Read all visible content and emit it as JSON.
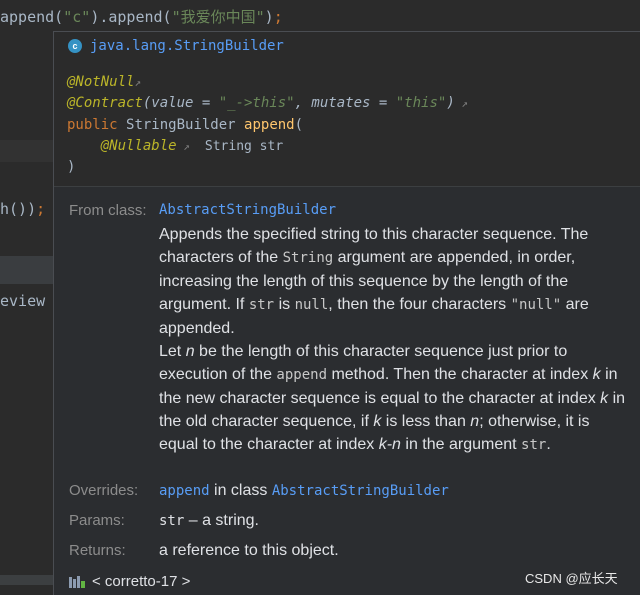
{
  "editor": {
    "line1": {
      "prefix": "append(",
      "arg1": "\"c\"",
      "mid": ").append(",
      "arg2": "\"我爱你中国\"",
      "suffix": ")",
      "semi": ";"
    },
    "line_h": {
      "text": "h())",
      "semi": ";"
    },
    "line_review": "eview"
  },
  "popup": {
    "class_badge": "c",
    "class_name": "java.lang.StringBuilder",
    "signature": {
      "notnull": "@NotNull",
      "contract_ann": "@Contract",
      "contract_open": "(value = ",
      "contract_value": "\"_->this\"",
      "contract_mid": ", mutates = ",
      "contract_mutates": "\"this\"",
      "contract_close": ")",
      "modifier": "public",
      "return_type": "StringBuilder",
      "method": "append",
      "paren_open": "(",
      "nullable": "@Nullable",
      "param_decl": "String str",
      "paren_close": ")"
    },
    "from_label": "From class:",
    "from_class": "AbstractStringBuilder",
    "description": {
      "p1_a": "Appends the specified string to this character sequence. The characters of the ",
      "p1_code1": "String",
      "p1_b": " argument are appended, in order, increasing the length of this sequence by the length of the argument. If ",
      "p1_code2": "str",
      "p1_c": " is ",
      "p1_code3": "null",
      "p1_d": ", then the four characters ",
      "p1_code4": "\"null\"",
      "p1_e": " are appended.",
      "p2_a": "Let ",
      "p2_n1": "n",
      "p2_b": " be the length of this character sequence just prior to execution of the ",
      "p2_code1": "append",
      "p2_c": " method. Then the character at index ",
      "p2_k1": "k",
      "p2_d": " in the new character sequence is equal to the character at index ",
      "p2_k2": "k",
      "p2_e": " in the old character sequence, if ",
      "p2_k3": "k",
      "p2_f": " is less than ",
      "p2_n2": "n",
      "p2_g": "; otherwise, it is equal to the character at index ",
      "p2_kn": "k-n",
      "p2_h": " in the argument ",
      "p2_code2": "str",
      "p2_i": "."
    },
    "overrides_label": "Overrides:",
    "overrides_method": "append",
    "overrides_mid": " in class ",
    "overrides_class": "AbstractStringBuilder",
    "params_label": "Params:",
    "params_name": "str",
    "params_desc": " – a string.",
    "returns_label": "Returns:",
    "returns_value": "a reference to this object.",
    "footer_lib": "< corretto-17 >",
    "icons": {
      "class": "class-icon",
      "link_arrow": "external-link-arrow-icon",
      "library": "library-icon"
    }
  },
  "watermark": "CSDN @应长天",
  "colors": {
    "link": "#589df6",
    "annotation": "#bbb529",
    "keyword": "#cc7832",
    "string": "#6a8759",
    "method": "#ffc66d"
  }
}
